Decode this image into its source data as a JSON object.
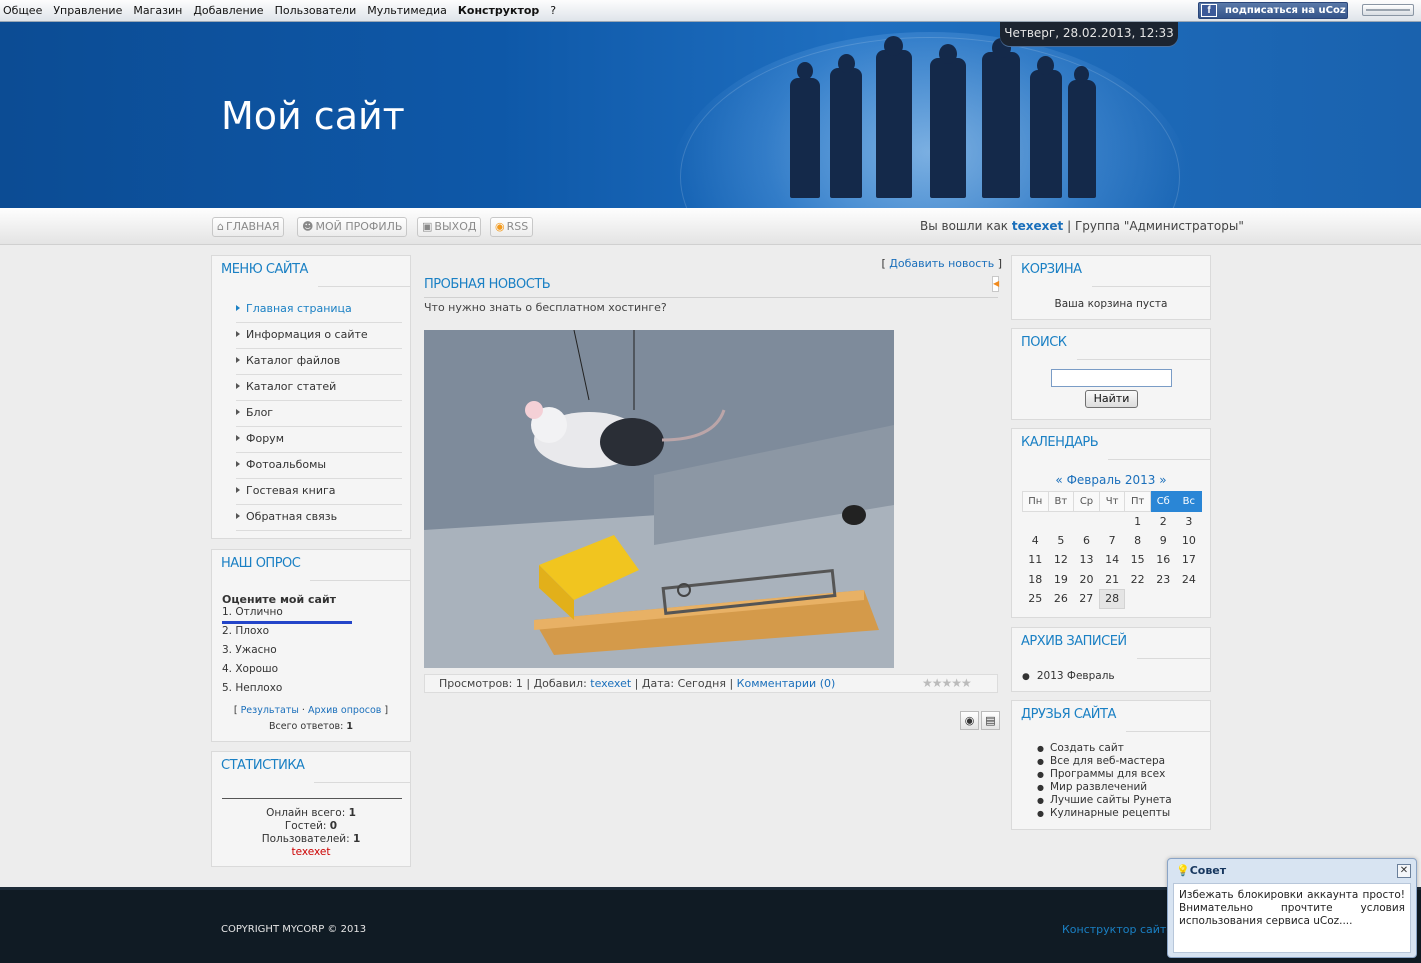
{
  "adminbar": {
    "items": [
      "Общее",
      "Управление",
      "Магазин",
      "Добавление",
      "Пользователи",
      "Мультимедиа",
      "Конструктор",
      "?"
    ],
    "subscribe": "подписаться на uCoz"
  },
  "header": {
    "title": "Мой сайт",
    "date": "Четверг, 28.02.2013, 12:33"
  },
  "nav": {
    "home": "ГЛАВНАЯ",
    "profile": "МОЙ ПРОФИЛЬ",
    "logout": "ВЫХОД",
    "rss": "RSS",
    "logged_prefix": "Вы вошли как",
    "username": "texexet",
    "group_text": "| Группа \"Администраторы\""
  },
  "left": {
    "menu_title": "Меню сайта",
    "menu": [
      "Главная страница",
      "Информация о сайте",
      "Каталог файлов",
      "Каталог статей",
      "Блог",
      "Форум",
      "Фотоальбомы",
      "Гостевая книга",
      "Обратная связь"
    ],
    "poll_title": "Наш опрос",
    "poll_question": "Оцените мой сайт",
    "poll_options": [
      "1. Отлично",
      "2. Плохо",
      "3. Ужасно",
      "4. Хорошо",
      "5. Неплохо"
    ],
    "poll_results": "Результаты",
    "poll_archive": "Архив опросов",
    "poll_total_label": "Всего ответов:",
    "poll_total": "1",
    "stats_title": "Статистика",
    "online_label": "Онлайн всего:",
    "online": "1",
    "guests_label": "Гостей:",
    "guests": "0",
    "users_label": "Пользователей:",
    "users": "1",
    "online_user": "texexet"
  },
  "content": {
    "add_news": "Добавить новость",
    "news_title": "Пробная новость",
    "news_text": "Что нужно знать о бесплатном хостинге?",
    "views_label": "Просмотров:",
    "views": "1",
    "added_label": "Добавил:",
    "author": "texexet",
    "date_label": "Дата:",
    "date": "Сегодня",
    "comments": "Комментарии (0)"
  },
  "right": {
    "cart_title": "Корзина",
    "cart_empty": "Ваша корзина пуста",
    "search_title": "Поиск",
    "search_button": "Найти",
    "search_value": "",
    "calendar_title": "Календарь",
    "calendar_month": "Февраль 2013",
    "calendar_prev": "«",
    "calendar_next": "»",
    "weekdays": [
      "Пн",
      "Вт",
      "Ср",
      "Чт",
      "Пт",
      "Сб",
      "Вс"
    ],
    "weeks": [
      [
        "",
        "",
        "",
        "",
        "1",
        "2",
        "3"
      ],
      [
        "4",
        "5",
        "6",
        "7",
        "8",
        "9",
        "10"
      ],
      [
        "11",
        "12",
        "13",
        "14",
        "15",
        "16",
        "17"
      ],
      [
        "18",
        "19",
        "20",
        "21",
        "22",
        "23",
        "24"
      ],
      [
        "25",
        "26",
        "27",
        "28",
        "",
        "",
        ""
      ]
    ],
    "today": "28",
    "archive_title": "Архив записей",
    "archive_item": "2013 Февраль",
    "friends_title": "Друзья сайта",
    "friends": [
      "Создать сайт",
      "Все для веб-мастера",
      "Программы для всех",
      "Мир развлечений",
      "Лучшие сайты Рунета",
      "Кулинарные рецепты"
    ]
  },
  "footer": {
    "copyright": "COPYRIGHT MYCORP © 2013",
    "constructor": "Конструктор сайтов"
  },
  "tip": {
    "title": "Совет",
    "text": "Избежать блокировки аккаунта просто! Внимательно прочтите условия использования сервиса uCoz....",
    "close": "✕"
  }
}
